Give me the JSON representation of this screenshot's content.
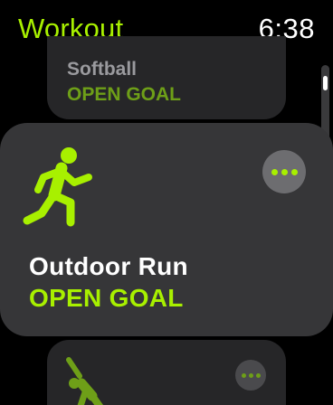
{
  "header": {
    "title": "Workout",
    "time": "6:38"
  },
  "colors": {
    "accent": "#a8f000",
    "accent_dim": "#6e9f18",
    "card": "#363638",
    "background": "#000000"
  },
  "workouts": [
    {
      "name": "Softball",
      "goal": "OPEN GOAL",
      "icon": "softball-icon"
    },
    {
      "name": "Outdoor Run",
      "goal": "OPEN GOAL",
      "icon": "running-figure-icon"
    },
    {
      "name": "",
      "goal": "",
      "icon": "yoga-stretch-icon"
    }
  ],
  "more_button": {
    "icon": "ellipsis-icon"
  }
}
